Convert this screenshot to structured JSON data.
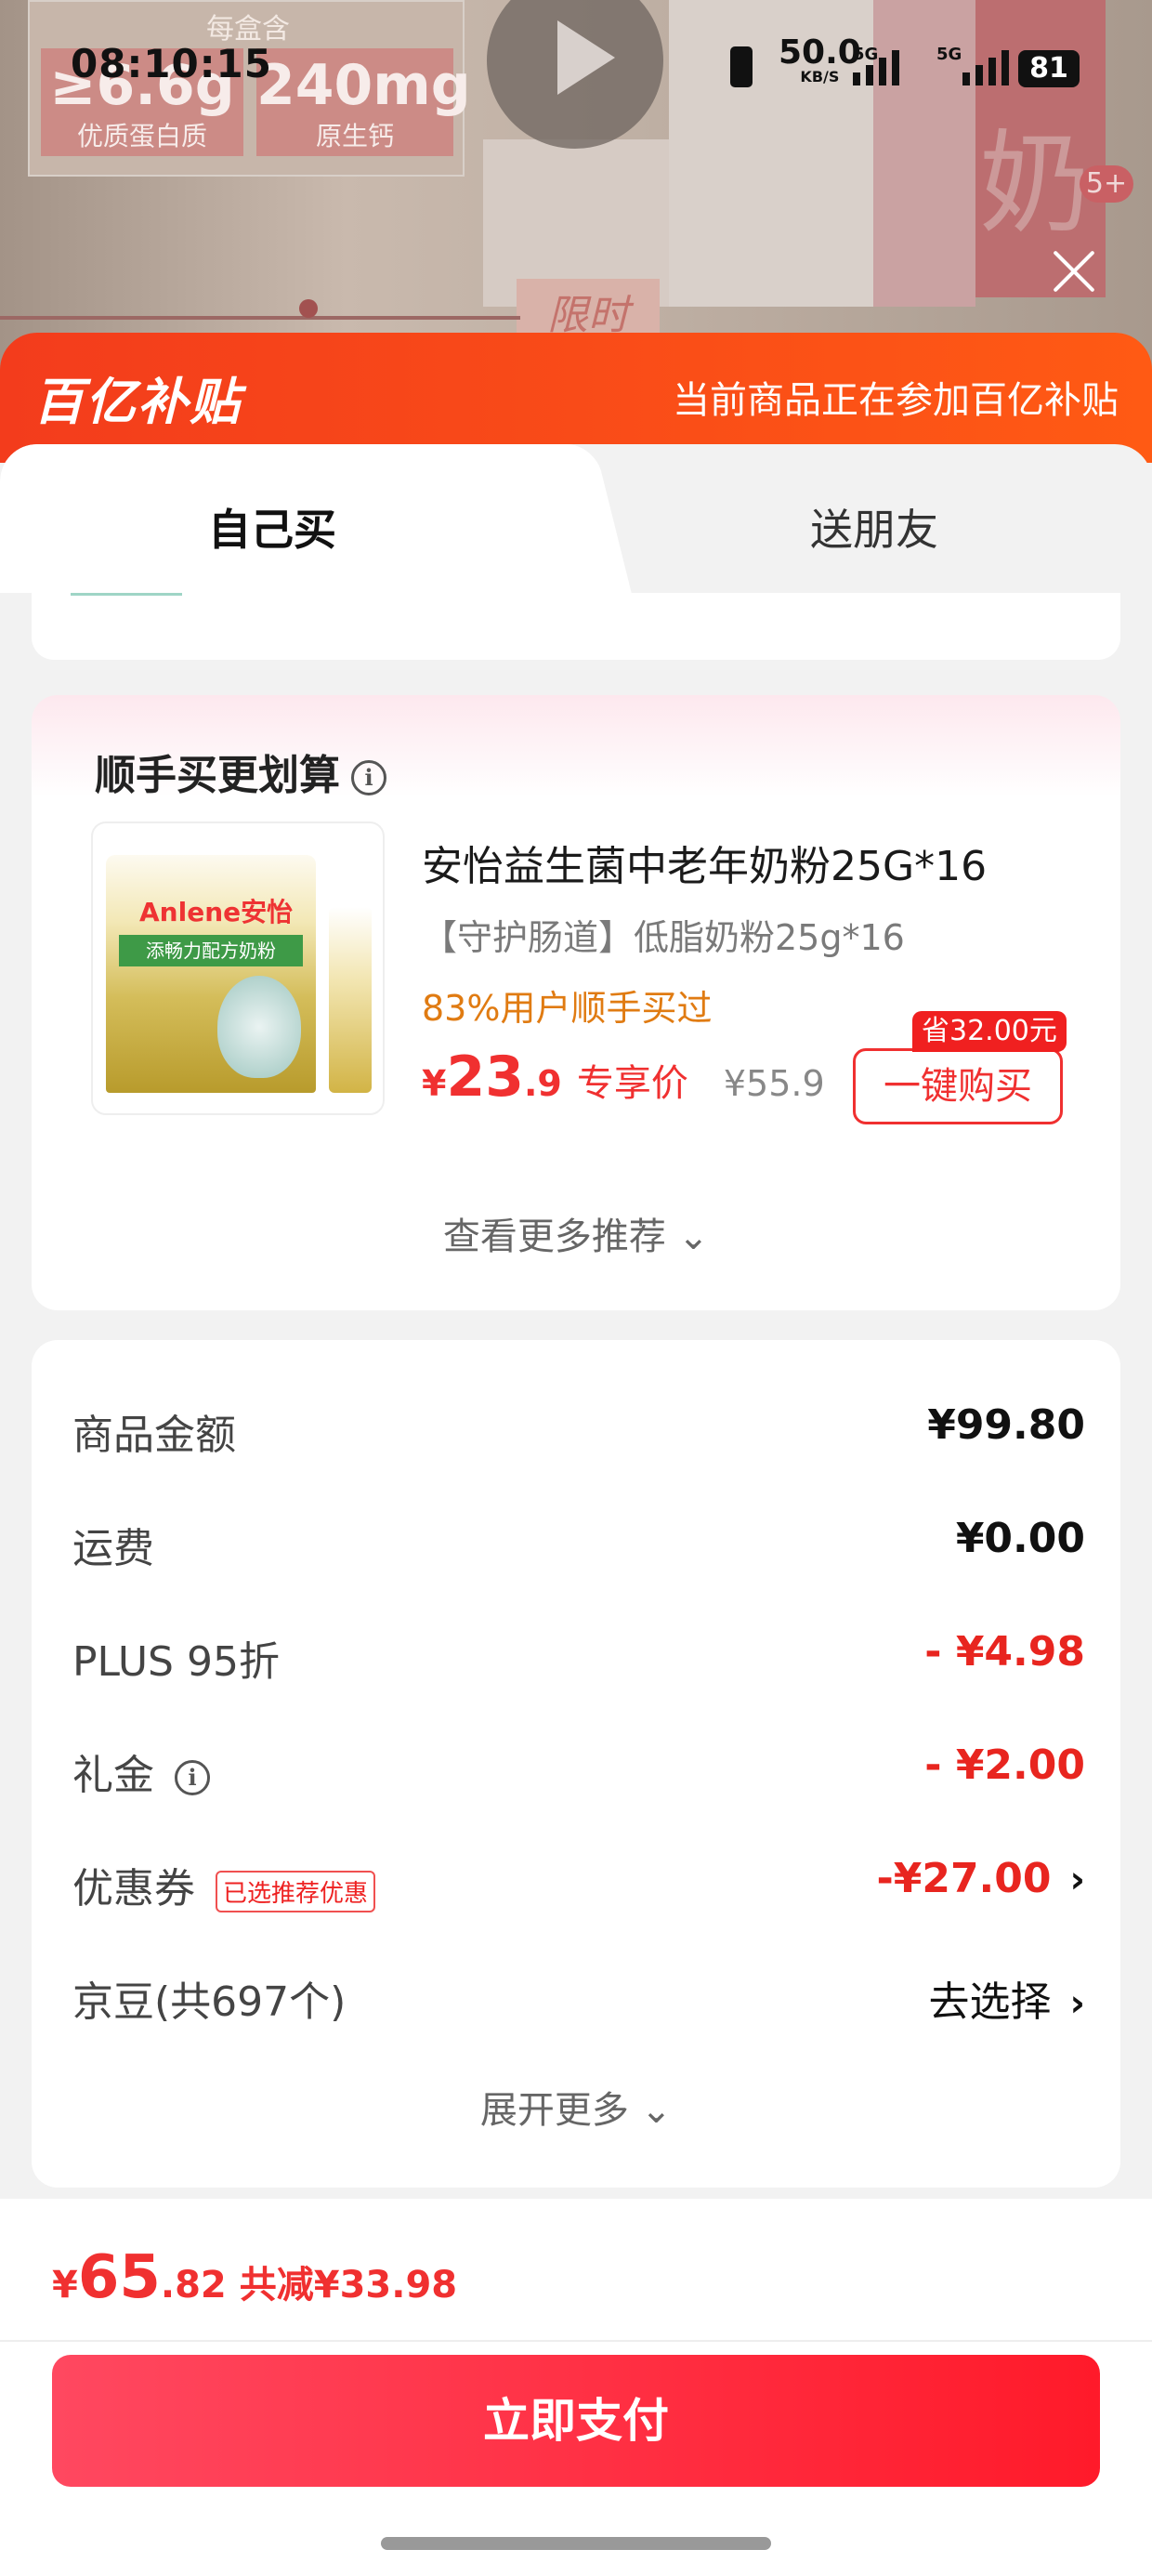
{
  "status_bar": {
    "time": "08:10:15",
    "net_speed": "50.0",
    "net_unit": "KB/S",
    "sig1_label": "5G",
    "sig2_label": "5G",
    "battery": "81"
  },
  "banner": {
    "per_box_label": "每盒含",
    "protein_value": "≥6.6g",
    "protein_label": "优质蛋白质",
    "calcium_value": "240mg",
    "calcium_label": "原生钙",
    "limited_label": "限时",
    "milk_char": "奶",
    "badge_count": "5+"
  },
  "sheet": {
    "brand": "百亿补贴",
    "brand_note": "当前商品正在参加百亿补贴",
    "tabs": [
      {
        "label": "自己买"
      },
      {
        "label": "送朋友"
      }
    ]
  },
  "recommend": {
    "title": "顺手买更划算",
    "product": {
      "logo": "Anlene安怡",
      "band_text": "添畅力配方奶粉",
      "name": "安怡益生菌中老年奶粉25G*16",
      "subtitle": "【守护肠道】低脂奶粉25g*16",
      "hot": "83%用户顺手买过",
      "price_symbol": "¥",
      "price_int": "23",
      "price_dec": ".9",
      "price_tag": "专享价",
      "old_price": "¥55.9",
      "save_badge": "省32.00元",
      "buy_label": "一键购买"
    },
    "more_label": "查看更多推荐 ⌄"
  },
  "summary": {
    "rows": [
      {
        "label": "商品金额",
        "value": "¥99.80"
      },
      {
        "label": "运费",
        "value": "¥0.00"
      },
      {
        "label": "PLUS 95折",
        "value": "- ¥4.98"
      },
      {
        "label": "礼金",
        "value": "- ¥2.00"
      },
      {
        "label": "优惠券",
        "tag": "已选推荐优惠",
        "value": "-¥27.00"
      },
      {
        "label": "京豆(共697个)",
        "value": "去选择"
      }
    ],
    "chevron": "›",
    "expand_label": "展开更多 ⌄"
  },
  "footer": {
    "total_symbol": "¥",
    "total_int": "65",
    "total_dec": ".82",
    "total_cut": "共减¥33.98",
    "pay_label": "立即支付"
  },
  "colors": {
    "brand_orange": "#f33c1c",
    "price_red": "#f03030",
    "pay_red": "#ff1a2a",
    "hot_orange": "#e07b12"
  }
}
